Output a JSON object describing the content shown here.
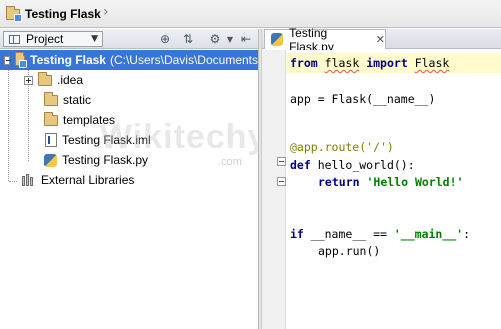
{
  "navbar": {
    "breadcrumb": "Testing Flask"
  },
  "project_pane": {
    "view_selector": "Project",
    "toolbar_icons": [
      "target-icon",
      "collapse-all-icon",
      "gear-icon",
      "hide-panel-icon"
    ],
    "tree": [
      {
        "label": "Testing Flask",
        "path": "(C:\\Users\\Davis\\Documents",
        "icon": "folder-icon",
        "expanded": true,
        "selected": true
      },
      {
        "label": ".idea",
        "icon": "folder-icon",
        "expanded": false
      },
      {
        "label": "static",
        "icon": "folder-icon"
      },
      {
        "label": "templates",
        "icon": "folder-icon"
      },
      {
        "label": "Testing Flask.iml",
        "icon": "iml-file-icon"
      },
      {
        "label": "Testing Flask.py",
        "icon": "python-file-icon"
      },
      {
        "label": "External Libraries",
        "icon": "library-icon"
      }
    ]
  },
  "editor": {
    "tab_label": "Testing Flask.py",
    "lines": {
      "l1_kw_from": "from",
      "l1_mod": "flask",
      "l1_kw_import": "import",
      "l1_name": "Flask",
      "l3": "app = Flask(__name__)",
      "l6": "@app.route('/')",
      "l7_kw": "def",
      "l7_rest": " hello_world():",
      "l8_kw": "return",
      "l8_str": "'Hello World!'",
      "l11_kw": "if",
      "l11_mid": " __name__ == ",
      "l11_str": "'__main__'",
      "l11_end": ":",
      "l12": "app.run()"
    }
  },
  "watermark": {
    "text": "Wikitechy",
    "suffix": ".com"
  },
  "colors": {
    "selection": "#3875d7",
    "current_line": "#fffbcc",
    "keyword": "#000080",
    "string": "#008000",
    "decorator": "#808000"
  }
}
